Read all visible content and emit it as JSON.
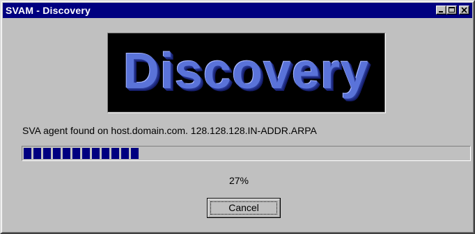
{
  "window": {
    "title": "SVAM - Discovery",
    "title_bar_color": "#000080",
    "controls": {
      "minimize_icon": "minimize-icon",
      "maximize_icon": "maximize-icon",
      "close_icon": "close-icon"
    }
  },
  "banner": {
    "text": "Discovery",
    "text_color": "#5a73d9",
    "background_color": "#000000"
  },
  "status": {
    "message": "SVA agent found on host.domain.com. 128.128.128.IN-ADDR.ARPA"
  },
  "progress": {
    "value_percent": 27,
    "label": "27%",
    "bar_color": "#000080"
  },
  "actions": {
    "cancel_label": "Cancel"
  }
}
